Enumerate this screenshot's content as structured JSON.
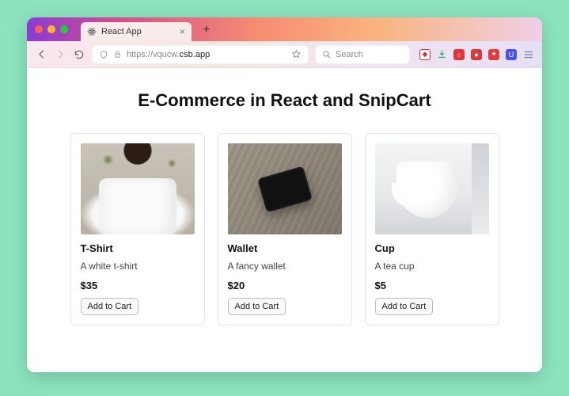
{
  "browser": {
    "tab_title": "React App",
    "url_prefix": "https://vqucw.",
    "url_host": "csb.app",
    "search_placeholder": "Search"
  },
  "page": {
    "title": "E-Commerce in React and SnipCart"
  },
  "products": [
    {
      "name": "T-Shirt",
      "desc": "A white t-shirt",
      "price": "$35",
      "cta": "Add to Cart",
      "img": "tshirt"
    },
    {
      "name": "Wallet",
      "desc": "A fancy wallet",
      "price": "$20",
      "cta": "Add to Cart",
      "img": "wallet"
    },
    {
      "name": "Cup",
      "desc": "A tea cup",
      "price": "$5",
      "cta": "Add to Cart",
      "img": "cup"
    }
  ]
}
